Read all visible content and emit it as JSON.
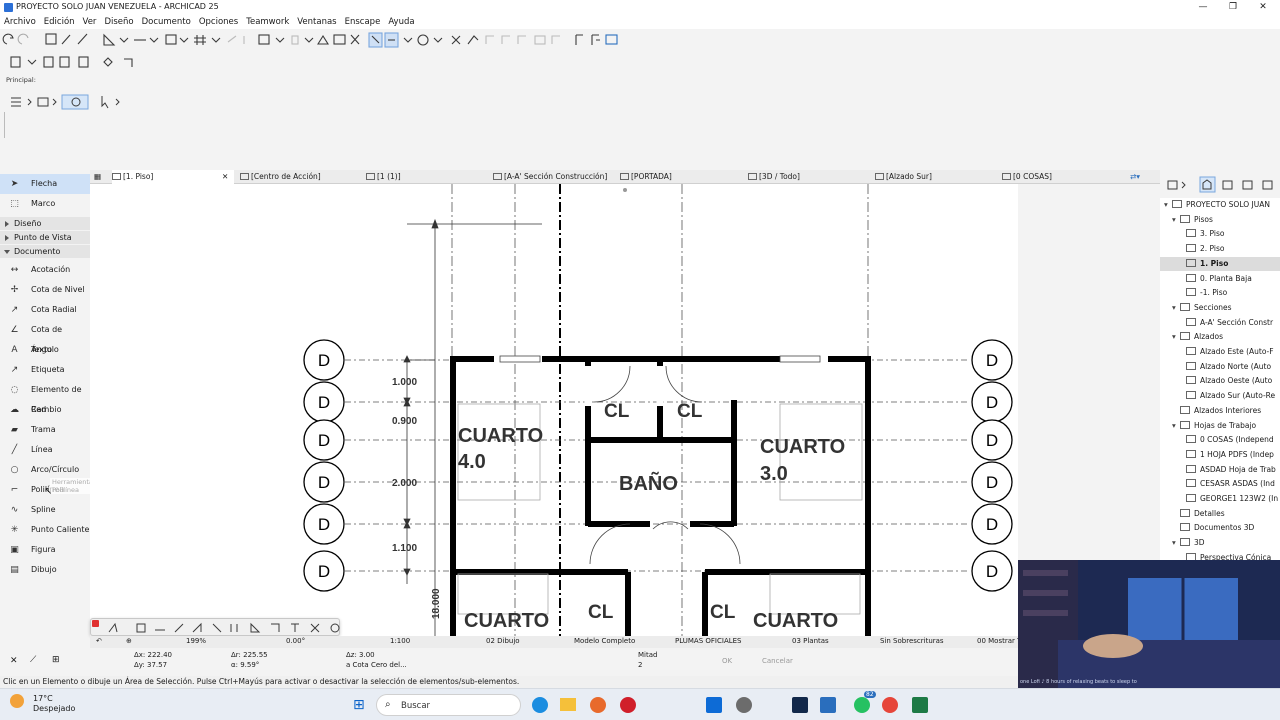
{
  "window": {
    "title": "PROYECTO SOLO JUAN VENEZUELA - ARCHICAD 25"
  },
  "menu": [
    "Archivo",
    "Edición",
    "Ver",
    "Diseño",
    "Documento",
    "Opciones",
    "Teamwork",
    "Ventanas",
    "Enscape",
    "Ayuda"
  ],
  "infobox": {
    "label": "Principal:"
  },
  "sidebar": {
    "top_items": [
      "Flecha",
      "Marco"
    ],
    "groups": [
      "Diseño",
      "Punto de Vista",
      "Documento"
    ],
    "doc_items": [
      "Acotación",
      "Cota de Nivel",
      "Cota Radial",
      "Cota de Ángulo",
      "Texto",
      "Etiqueta",
      "Elemento de Red",
      "Cambio",
      "Trama",
      "Línea",
      "Arco/Círculo",
      "Polilínea",
      "Spline",
      "Punto Caliente",
      "Figura",
      "Dibujo"
    ],
    "tooltip": "Herramienta Polilínea"
  },
  "tabs": [
    "[1. Piso]",
    "[Centro de Acción]",
    "[1 (1)]",
    "[A-A' Sección Construcción]",
    "[PORTADA]",
    "[3D / Todo]",
    "[Alzado Sur]",
    "[0 COSAS]"
  ],
  "drawing": {
    "grid_labels": [
      "D",
      "D",
      "D",
      "D",
      "D",
      "D"
    ],
    "dimensions": [
      "1.000",
      "0.900",
      "2.000",
      "1.100",
      "18.000"
    ],
    "rooms": [
      "CUARTO",
      "4.0",
      "CL",
      "CL",
      "BAÑO",
      "CUARTO",
      "3.0",
      "CUARTO",
      "CL",
      "CL",
      "CUARTO"
    ]
  },
  "navigator": {
    "root": "PROYECTO SOLO JUAN",
    "items": [
      {
        "label": "Pisos",
        "level": 1,
        "open": true
      },
      {
        "label": "3. Piso",
        "level": 2
      },
      {
        "label": "2. Piso",
        "level": 2
      },
      {
        "label": "1. Piso",
        "level": 2,
        "selected": true
      },
      {
        "label": "0. Planta Baja",
        "level": 2
      },
      {
        "label": "-1. Piso",
        "level": 2
      },
      {
        "label": "Secciones",
        "level": 1,
        "open": true
      },
      {
        "label": "A-A' Sección Constr",
        "level": 2
      },
      {
        "label": "Alzados",
        "level": 1,
        "open": true
      },
      {
        "label": "Alzado Este (Auto-F",
        "level": 2
      },
      {
        "label": "Alzado Norte (Auto",
        "level": 2
      },
      {
        "label": "Alzado Oeste (Auto",
        "level": 2
      },
      {
        "label": "Alzado Sur (Auto-Re",
        "level": 2
      },
      {
        "label": "Alzados Interiores",
        "level": 1
      },
      {
        "label": "Hojas de Trabajo",
        "level": 1,
        "open": true
      },
      {
        "label": "0 COSAS (Independ",
        "level": 2
      },
      {
        "label": "1 HOJA PDFS (Indep",
        "level": 2
      },
      {
        "label": "ASDAD Hoja de Trab",
        "level": 2
      },
      {
        "label": "CESASR ASDAS (Ind",
        "level": 2
      },
      {
        "label": "GEORGE1 123W2 (In",
        "level": 2
      },
      {
        "label": "Detalles",
        "level": 1
      },
      {
        "label": "Documentos 3D",
        "level": 1
      },
      {
        "label": "3D",
        "level": 1,
        "open": true
      },
      {
        "label": "Perspectiva Cónica",
        "level": 2
      }
    ]
  },
  "status": {
    "zoom": "199%",
    "angle": "0.00°",
    "scale": "1:100",
    "layer": "02 Dibujo",
    "model": "Modelo Completo",
    "pens": "PLUMAS OFICIALES",
    "plans": "03 Plantas",
    "override": "Sin Sobrescrituras",
    "show": "00 Mostrar T"
  },
  "coords": {
    "ax": "Δx: 222.40",
    "ay": "Δy: 37.57",
    "ar": "Δr: 225.55",
    "alpha": "α: 9.59°",
    "az": "Δz: 3.00",
    "ref": "a Cota Cero del...",
    "mitad": "Mitad",
    "mitad_n": "2",
    "ok": "OK",
    "cancel": "Cancelar"
  },
  "hint": "Clic en un Elemento o dibuje un Área de Selección. Pulse Ctrl+Mayús para activar o desactivar la selección de elementos/sub-elementos.",
  "taskbar": {
    "temp": "17°C",
    "weather": "Despejado",
    "search": "Buscar",
    "badge": "82"
  },
  "video": {
    "caption": "one Lofi ♪ 8 hours of relaxing beats to sleep to"
  }
}
